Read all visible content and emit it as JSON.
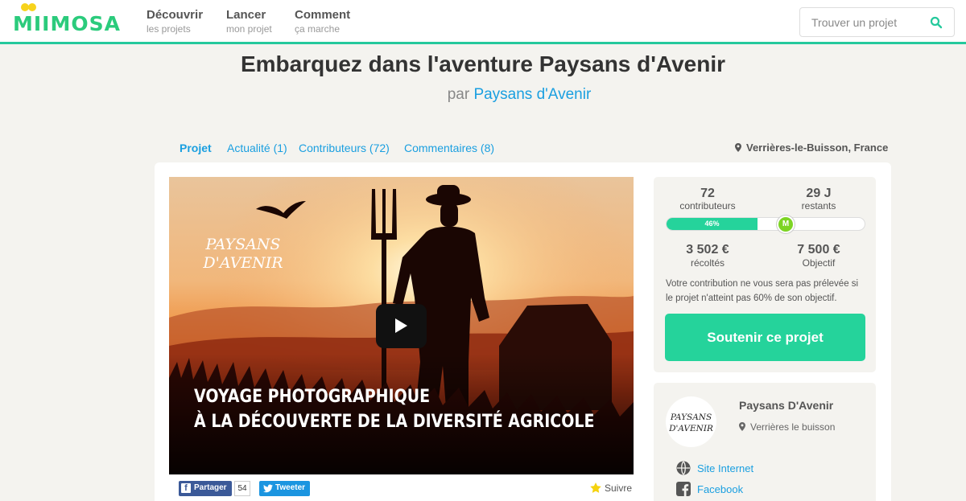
{
  "header": {
    "logo_text": "MIIMOSA",
    "nav": [
      {
        "main": "Découvrir",
        "sub": "les projets"
      },
      {
        "main": "Lancer",
        "sub": "mon projet"
      },
      {
        "main": "Comment",
        "sub": "ça marche"
      }
    ],
    "search_placeholder": "Trouver un projet"
  },
  "project": {
    "title": "Embarquez dans l'aventure Paysans d'Avenir",
    "by_prefix": "par",
    "author": "Paysans d'Avenir"
  },
  "tabs": [
    {
      "label": "Projet",
      "active": true
    },
    {
      "label": "Actualité (1)",
      "active": false
    },
    {
      "label": "Contributeurs (72)",
      "active": false
    },
    {
      "label": "Commentaires (8)",
      "active": false
    }
  ],
  "location": "Verrières-le-Buisson, France",
  "video": {
    "logo_line1": "PAYSANS",
    "logo_line2": "D'AVENIR",
    "caption_line1": "VOYAGE PHOTOGRAPHIQUE",
    "caption_line2": "À LA DÉCOUVERTE DE LA DIVERSITÉ AGRICOLE"
  },
  "share": {
    "facebook_label": "Partager",
    "facebook_count": "54",
    "tweet_label": "Tweeter",
    "follow_label": "Suivre"
  },
  "stats": {
    "contributors_value": "72",
    "contributors_label": "contributeurs",
    "days_value": "29 J",
    "days_label": "restants",
    "progress_percent": 46,
    "progress_label": "46%",
    "threshold_percent": 60,
    "marker_letter": "M",
    "collected_value": "3 502 €",
    "collected_label": "récoltés",
    "goal_value": "7 500 €",
    "goal_label": "Objectif",
    "disclaimer": "Votre contribution ne vous sera pas prélevée si le projet n'atteint pas 60% de son objectif.",
    "support_button": "Soutenir ce projet"
  },
  "author_panel": {
    "name": "Paysans D'Avenir",
    "location": "Verrières le buisson",
    "avatar_line1": "PAYSANS",
    "avatar_line2": "D'AVENIR",
    "links": [
      {
        "label": "Site Internet",
        "icon": "globe-icon"
      },
      {
        "label": "Facebook",
        "icon": "facebook-icon"
      }
    ]
  },
  "colors": {
    "accent_green": "#25d39b",
    "link_blue": "#1a9fe0",
    "logo_green": "#2bcb7c",
    "logo_yellow": "#f7d31c"
  }
}
